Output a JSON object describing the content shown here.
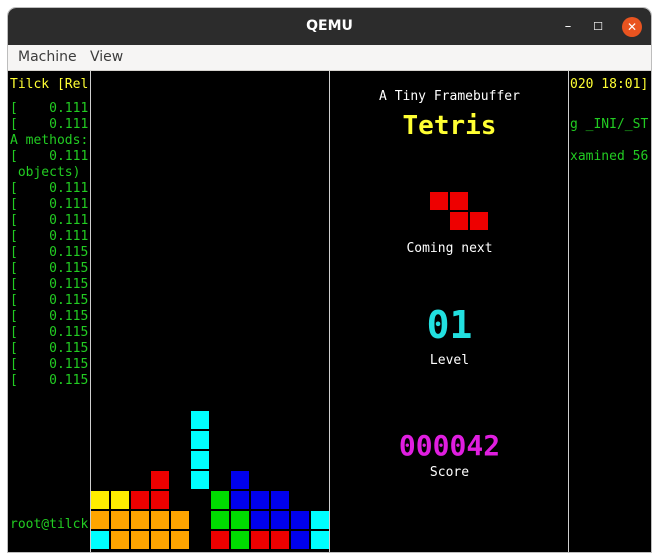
{
  "window": {
    "title": "QEMU"
  },
  "menu": [
    "Machine",
    "View"
  ],
  "terminal": {
    "header": "Tilck [Rel",
    "header_right": "020 18:01]",
    "lines": [
      {
        "text": "[    0.111",
        "color": "green"
      },
      {
        "text": "[    0.111",
        "color": "green"
      },
      {
        "text": "A methods:",
        "color": "green"
      },
      {
        "text": "[    0.111",
        "color": "green"
      },
      {
        "text": " objects)",
        "color": "green"
      },
      {
        "text": "[    0.111",
        "color": "green"
      },
      {
        "text": "[    0.111",
        "color": "green"
      },
      {
        "text": "[    0.111",
        "color": "green"
      },
      {
        "text": "[    0.111",
        "color": "green"
      },
      {
        "text": "[    0.115",
        "color": "green"
      },
      {
        "text": "[    0.115",
        "color": "green"
      },
      {
        "text": "[    0.115",
        "color": "green"
      },
      {
        "text": "[    0.115",
        "color": "green"
      },
      {
        "text": "[    0.115",
        "color": "green"
      },
      {
        "text": "[    0.115",
        "color": "green"
      },
      {
        "text": "[    0.115",
        "color": "green"
      },
      {
        "text": "[    0.115",
        "color": "green"
      },
      {
        "text": "[    0.115",
        "color": "green"
      }
    ],
    "right_lines": [
      "g _INI/_ST",
      "xamined 56"
    ],
    "prompt": "root@tilck"
  },
  "game": {
    "subtitle": "A Tiny Framebuffer",
    "title": "Tetris",
    "next_label": "Coming next",
    "level": "01",
    "level_label": "Level",
    "score": "000042",
    "score_label": "Score",
    "colors": {
      "Y": "#ffee00",
      "R": "#ee0000",
      "O": "#ffa500",
      "C": "#00ffff",
      "G": "#00dd00",
      "B": "#0000ee"
    },
    "board_rows": [
      "..........",
      "..........",
      "..........",
      "..........",
      "..........",
      "..........",
      "..........",
      "..........",
      "..........",
      "..........",
      "..........",
      "..........",
      "..........",
      "..........",
      "..........",
      "..........",
      "..........",
      "..........",
      "..........",
      "..........",
      "..........",
      "..........",
      "..........",
      "..........",
      "..........",
      "..........",
      "..........",
      "..........",
      ".........."
    ],
    "board_cells": [
      [
        "C",
        5,
        17
      ],
      [
        "C",
        5,
        18
      ],
      [
        "C",
        5,
        19
      ],
      [
        "C",
        5,
        20
      ],
      [
        "R",
        3,
        20
      ],
      [
        "B",
        7,
        20
      ],
      [
        "Y",
        0,
        21
      ],
      [
        "Y",
        1,
        21
      ],
      [
        "R",
        2,
        21
      ],
      [
        "R",
        3,
        21
      ],
      [
        "G",
        6,
        21
      ],
      [
        "B",
        7,
        21
      ],
      [
        "B",
        8,
        21
      ],
      [
        "B",
        9,
        21
      ],
      [
        "O",
        0,
        22
      ],
      [
        "O",
        1,
        22
      ],
      [
        "O",
        2,
        22
      ],
      [
        "O",
        3,
        22
      ],
      [
        "O",
        4,
        22
      ],
      [
        "G",
        6,
        22
      ],
      [
        "G",
        7,
        22
      ],
      [
        "B",
        8,
        22
      ],
      [
        "B",
        9,
        22
      ],
      [
        "B",
        10,
        22
      ],
      [
        "C",
        11,
        22
      ],
      [
        "C",
        0,
        23
      ],
      [
        "O",
        1,
        23
      ],
      [
        "O",
        2,
        23
      ],
      [
        "O",
        3,
        23
      ],
      [
        "O",
        4,
        23
      ],
      [
        "R",
        6,
        23
      ],
      [
        "G",
        7,
        23
      ],
      [
        "R",
        8,
        23
      ],
      [
        "R",
        9,
        23
      ],
      [
        "B",
        10,
        23
      ],
      [
        "C",
        11,
        23
      ]
    ],
    "next_piece": [
      [
        "R",
        0,
        0
      ],
      [
        "R",
        1,
        0
      ],
      [
        "R",
        1,
        1
      ],
      [
        "R",
        2,
        1
      ]
    ]
  }
}
